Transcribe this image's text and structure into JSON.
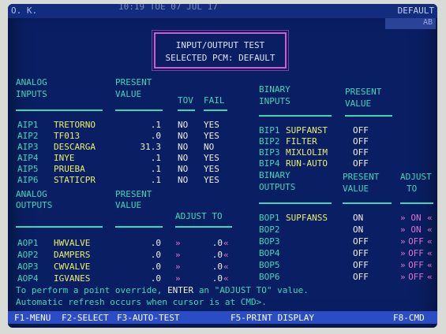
{
  "header": {
    "ok": "O. K.",
    "time_date": "10:19  TUE  07 JUL 17",
    "pcm_name": "DEFAULT",
    "corner_code": "AB"
  },
  "title": {
    "line1": "INPUT/OUTPUT TEST",
    "line2": "SELECTED PCM: DEFAULT"
  },
  "analog_inputs": {
    "heading_line1": "ANALOG",
    "heading_line2": "INPUTS",
    "present_line1": "PRESENT",
    "present_line2": "VALUE",
    "tov_heading": "TOV",
    "fail_heading": "FAIL",
    "rows": [
      {
        "id": "AIP1",
        "name": "TRETORNO",
        "value": ".1",
        "tov": "NO",
        "fail": "YES"
      },
      {
        "id": "AIP2",
        "name": "TF013",
        "value": ".0",
        "tov": "NO",
        "fail": "YES"
      },
      {
        "id": "AIP3",
        "name": "DESCARGA",
        "value": "31.3",
        "tov": "NO",
        "fail": "NO"
      },
      {
        "id": "AIP4",
        "name": "INYE",
        "value": ".1",
        "tov": "NO",
        "fail": "YES"
      },
      {
        "id": "AIP5",
        "name": "PRUEBA",
        "value": ".1",
        "tov": "NO",
        "fail": "YES"
      },
      {
        "id": "AIP6",
        "name": "STATICPR",
        "value": ".1",
        "tov": "NO",
        "fail": "YES"
      }
    ]
  },
  "analog_outputs": {
    "heading_line1": "ANALOG",
    "heading_line2": "OUTPUTS",
    "present_line1": "PRESENT",
    "present_line2": "VALUE",
    "adjust_heading": "ADJUST TO",
    "rows": [
      {
        "id": "AOP1",
        "name": "HWVALVE",
        "value": ".0",
        "adjust": ".0"
      },
      {
        "id": "AOP2",
        "name": "DAMPERS",
        "value": ".0",
        "adjust": ".0"
      },
      {
        "id": "AOP3",
        "name": "CWVALVE",
        "value": ".0",
        "adjust": ".0"
      },
      {
        "id": "AOP4",
        "name": "IGVANES",
        "value": ".0",
        "adjust": ".0"
      }
    ]
  },
  "binary_inputs": {
    "heading_line1": "BINARY",
    "heading_line2": "INPUTS",
    "present_line1": "PRESENT",
    "present_line2": "VALUE",
    "rows": [
      {
        "id": "BIP1",
        "name": "SUPFANST",
        "value": "OFF"
      },
      {
        "id": "BIP2",
        "name": "FILTER",
        "value": "OFF"
      },
      {
        "id": "BIP3",
        "name": "MIXLOLIM",
        "value": "OFF"
      },
      {
        "id": "BIP4",
        "name": "RUN-AUTO",
        "value": "OFF"
      }
    ]
  },
  "binary_outputs": {
    "heading_line1": "BINARY",
    "heading_line2": "OUTPUTS",
    "present_line1": "PRESENT",
    "present_line2": "VALUE",
    "adjust_line1": "ADJUST",
    "adjust_line2": "TO",
    "rows": [
      {
        "id": "BOP1",
        "name": "SUPFANSS",
        "value": "ON",
        "adjust": "ON"
      },
      {
        "id": "BOP2",
        "name": "",
        "value": "ON",
        "adjust": "ON"
      },
      {
        "id": "BOP3",
        "name": "",
        "value": "OFF",
        "adjust": "OFF"
      },
      {
        "id": "BOP4",
        "name": "",
        "value": "OFF",
        "adjust": "OFF"
      },
      {
        "id": "BOP5",
        "name": "",
        "value": "OFF",
        "adjust": "OFF"
      },
      {
        "id": "BOP6",
        "name": "",
        "value": "OFF",
        "adjust": "OFF"
      }
    ]
  },
  "adjust_marker_left": "»",
  "adjust_marker_right": "«",
  "messages": {
    "line1_a": "To perform a point override,",
    "line1_b": "ENTER",
    "line1_c": "an \"ADJUST TO\" value.",
    "line2": "Automatic refresh occurs when cursor is at CMD>."
  },
  "footer": {
    "f1": "F1-MENU",
    "f2": "F2-SELECT",
    "f3": "F3-AUTO-TEST",
    "f5": "F5-PRINT DISPLAY",
    "f8": "F8-CMD"
  },
  "colors": {
    "screen_bg": "#0a1f63",
    "heading": "#3fd6b6",
    "value": "#eef0e4",
    "label": "#e9ef6a",
    "marker": "#dd72cc",
    "footer_bg": "#2a4cc4"
  }
}
